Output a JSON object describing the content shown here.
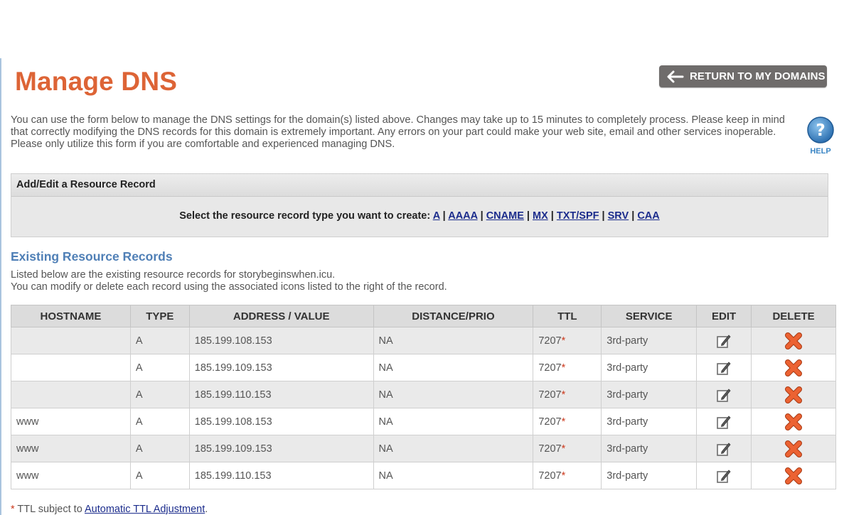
{
  "page": {
    "title": "Manage DNS",
    "return_button": "RETURN TO MY DOMAINS",
    "intro": "You can use the form below to manage the DNS settings for the domain(s) listed above. Changes may take up to 15 minutes to completely process. Please keep in mind that correctly modifying the DNS records for this domain is extremely important. Any errors on your part could make your web site, email and other services inoperable. Please only utilize this form if you are comfortable and experienced managing DNS.",
    "help_label": "HELP"
  },
  "add_record": {
    "heading": "Add/Edit a Resource Record",
    "prompt": "Select the resource record type you want to create:",
    "types": [
      "A",
      "AAAA",
      "CNAME",
      "MX",
      "TXT/SPF",
      "SRV",
      "CAA"
    ],
    "separator": " | "
  },
  "existing": {
    "heading": "Existing Resource Records",
    "desc_line1": "Listed below are the existing resource records for storybeginswhen.icu.",
    "desc_line2": "You can modify or delete each record using the associated icons listed to the right of the record."
  },
  "table": {
    "columns": [
      "HOSTNAME",
      "TYPE",
      "ADDRESS / VALUE",
      "DISTANCE/PRIO",
      "TTL",
      "SERVICE",
      "EDIT",
      "DELETE"
    ],
    "rows": [
      {
        "hostname": "",
        "type": "A",
        "address": "185.199.108.153",
        "prio": "NA",
        "ttl": "7207",
        "service": "3rd-party"
      },
      {
        "hostname": "",
        "type": "A",
        "address": "185.199.109.153",
        "prio": "NA",
        "ttl": "7207",
        "service": "3rd-party"
      },
      {
        "hostname": "",
        "type": "A",
        "address": "185.199.110.153",
        "prio": "NA",
        "ttl": "7207",
        "service": "3rd-party"
      },
      {
        "hostname": "www",
        "type": "A",
        "address": "185.199.108.153",
        "prio": "NA",
        "ttl": "7207",
        "service": "3rd-party"
      },
      {
        "hostname": "www",
        "type": "A",
        "address": "185.199.109.153",
        "prio": "NA",
        "ttl": "7207",
        "service": "3rd-party"
      },
      {
        "hostname": "www",
        "type": "A",
        "address": "185.199.110.153",
        "prio": "NA",
        "ttl": "7207",
        "service": "3rd-party"
      }
    ],
    "ttl_marker": "*"
  },
  "footnote": {
    "marker": "*",
    "text": " TTL subject to ",
    "link": "Automatic TTL Adjustment",
    "end": "."
  },
  "icons": {
    "return": "arrow-left-icon",
    "help": "question-circle-icon",
    "edit": "edit-pencil-icon",
    "delete": "delete-x-icon"
  },
  "colors": {
    "title": "#dd6436",
    "section_heading": "#4f7fb6",
    "link": "#1b2c8c",
    "delete_icon": "#e05a2b",
    "help_icon": "#3b86c5"
  }
}
